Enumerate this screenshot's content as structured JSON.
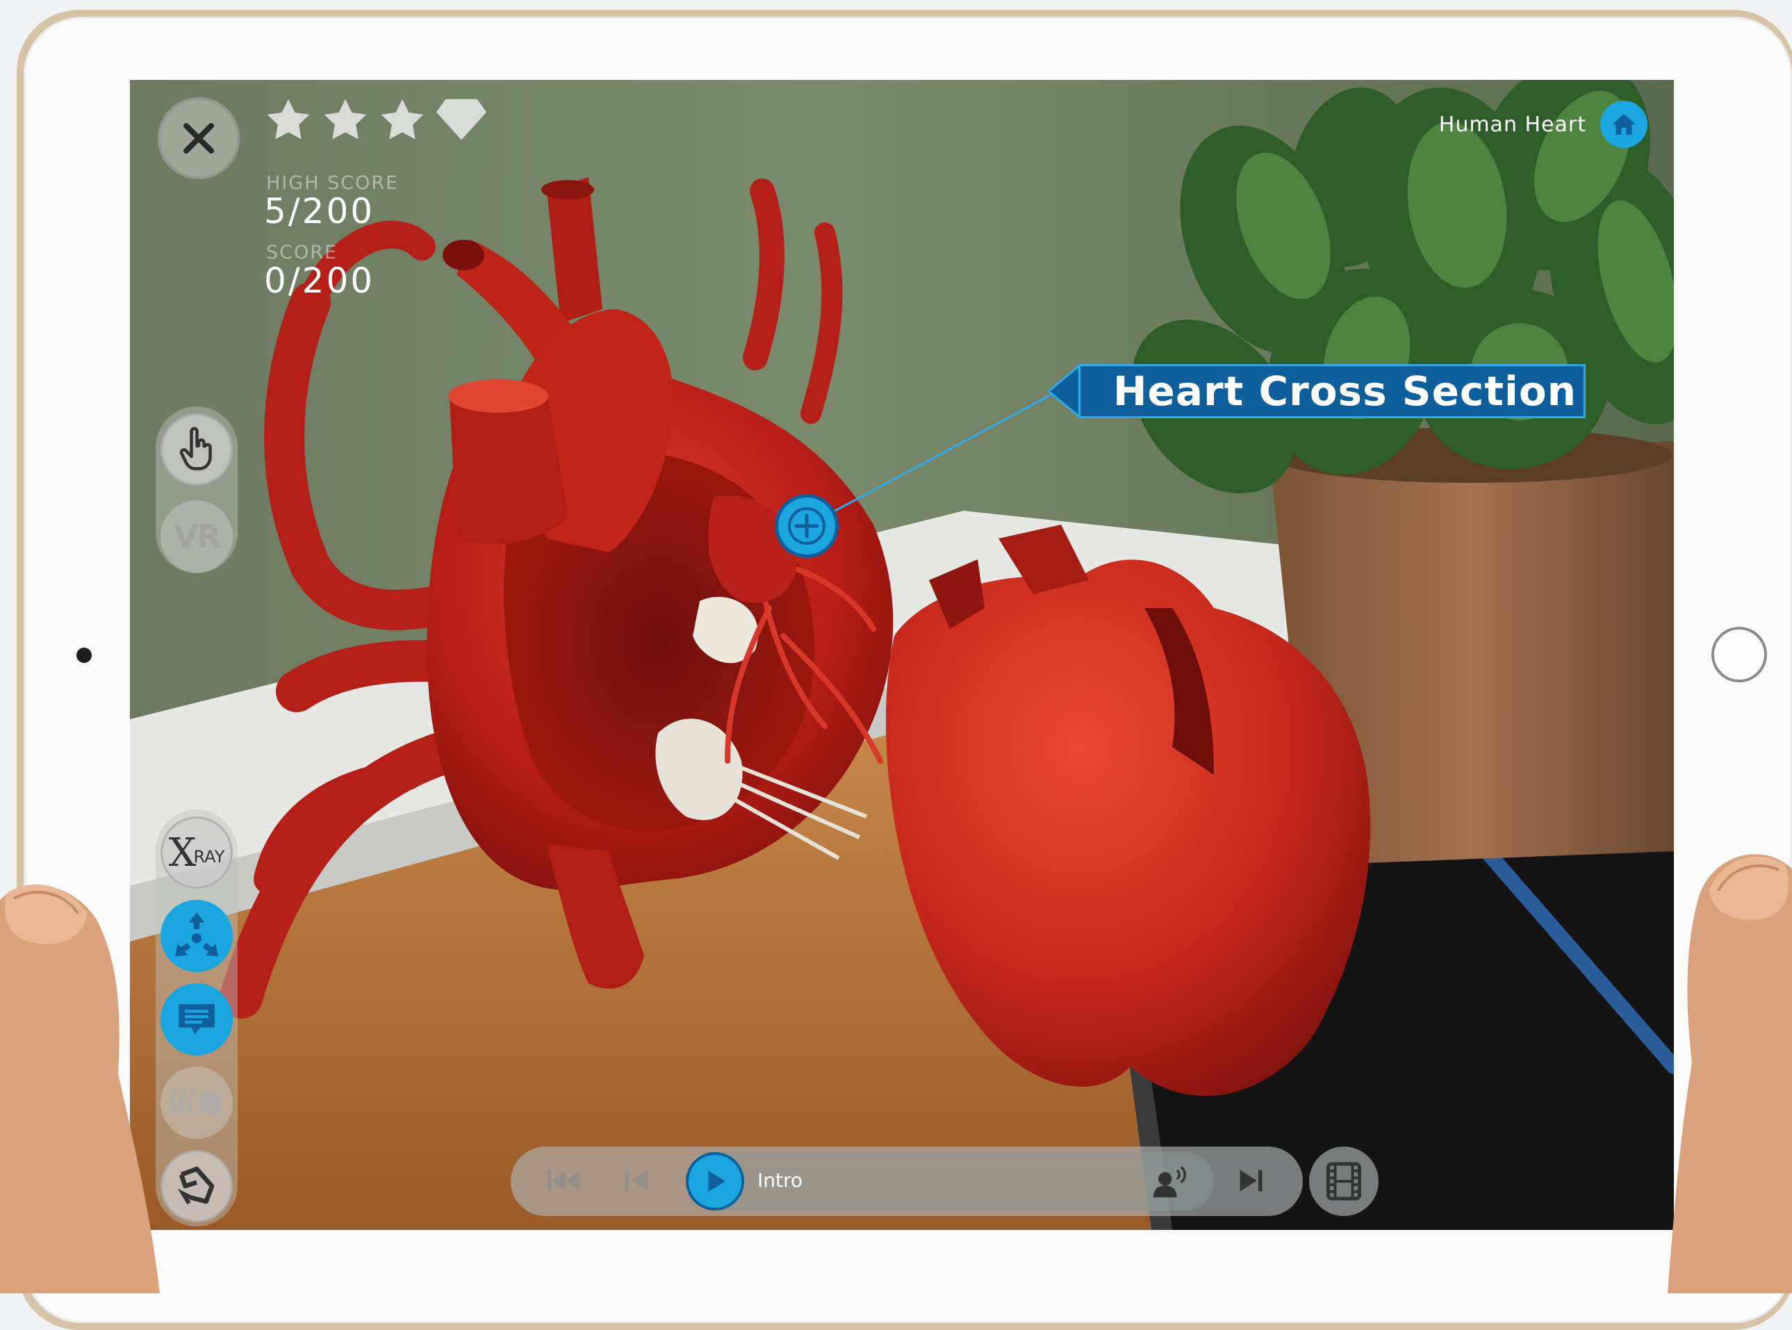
{
  "app": {
    "title": "Human Heart",
    "callout_label": "Heart Cross Section",
    "rating": {
      "stars_filled": 3,
      "stars_total": 3,
      "gem": "diamond-icon"
    }
  },
  "scores": {
    "high_score_label": "HIGH SCORE",
    "high_score_value": "5/200",
    "score_label": "SCORE",
    "score_value": "0/200"
  },
  "toolbar": {
    "vr_label": "VR",
    "xray_label_x": "X",
    "xray_label_ray": "RAY",
    "icons": [
      "close-icon",
      "hand-pointer-icon",
      "move-arrows-icon",
      "chat-icon",
      "sound-waves-icon",
      "rotate-icon"
    ]
  },
  "media": {
    "track_label": "Intro",
    "icons": [
      "skip-back-icon",
      "previous-icon",
      "play-icon",
      "audio-icon",
      "next-icon",
      "film-icon"
    ]
  },
  "colors": {
    "accent": "#1ba6e0",
    "accent_dark": "#0f5f9c",
    "heart": "#c8241d"
  }
}
